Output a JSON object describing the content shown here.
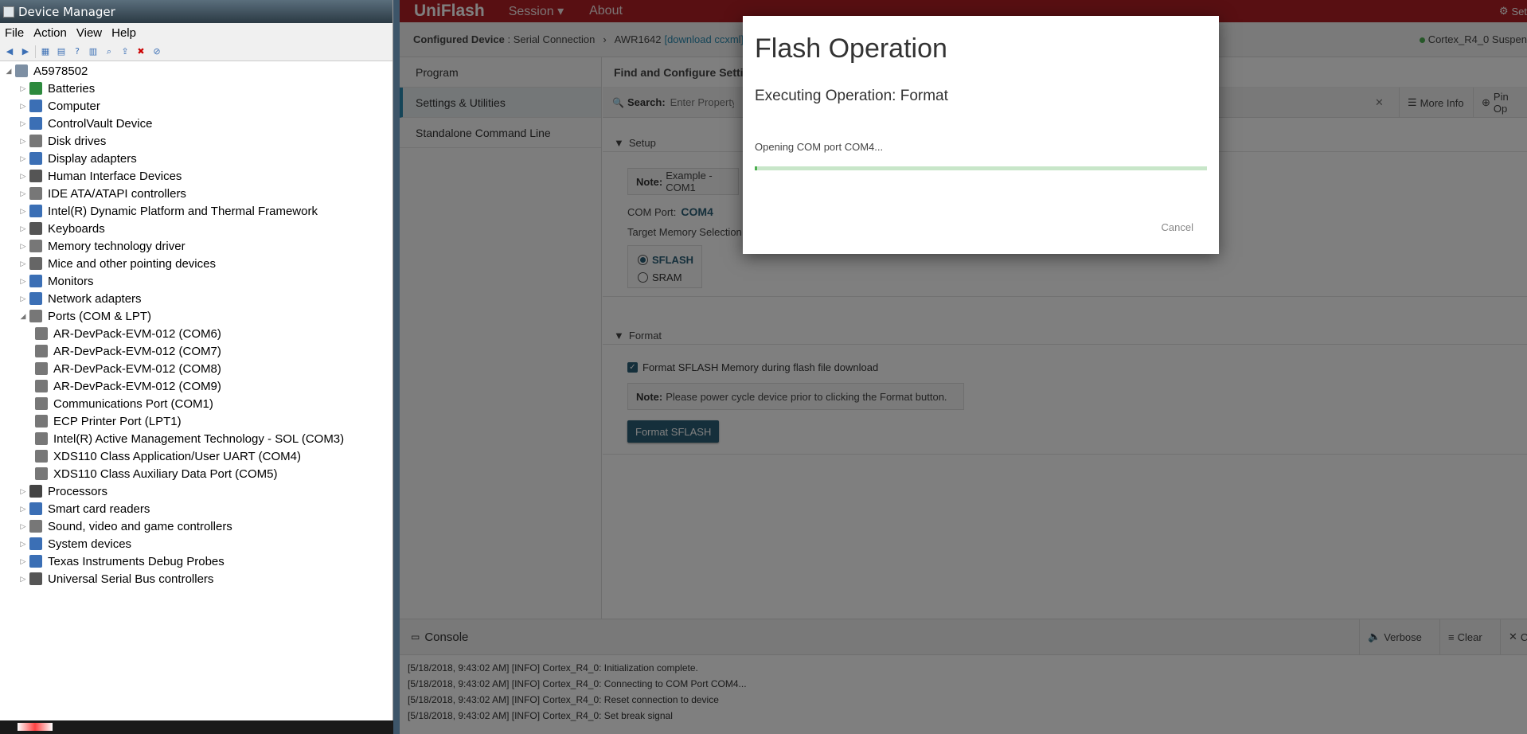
{
  "device_manager": {
    "title": "Device Manager",
    "menu": [
      "File",
      "Action",
      "View",
      "Help"
    ],
    "root": "A5978502",
    "items": [
      {
        "label": "Batteries",
        "icon": "battery-icon",
        "color": "#2d8a3e",
        "level": 1,
        "expanded": false
      },
      {
        "label": "Computer",
        "icon": "computer-icon",
        "color": "#3b6fb5",
        "level": 1,
        "expanded": false
      },
      {
        "label": "ControlVault Device",
        "icon": "security-device-icon",
        "color": "#3b6fb5",
        "level": 1,
        "expanded": false
      },
      {
        "label": "Disk drives",
        "icon": "disk-drive-icon",
        "color": "#777777",
        "level": 1,
        "expanded": false
      },
      {
        "label": "Display adapters",
        "icon": "display-adapter-icon",
        "color": "#3b6fb5",
        "level": 1,
        "expanded": false
      },
      {
        "label": "Human Interface Devices",
        "icon": "hid-icon",
        "color": "#555555",
        "level": 1,
        "expanded": false
      },
      {
        "label": "IDE ATA/ATAPI controllers",
        "icon": "ide-controller-icon",
        "color": "#777777",
        "level": 1,
        "expanded": false
      },
      {
        "label": "Intel(R) Dynamic Platform and Thermal Framework",
        "icon": "thermal-framework-icon",
        "color": "#3b6fb5",
        "level": 1,
        "expanded": false
      },
      {
        "label": "Keyboards",
        "icon": "keyboard-icon",
        "color": "#555555",
        "level": 1,
        "expanded": false
      },
      {
        "label": "Memory technology driver",
        "icon": "memory-driver-icon",
        "color": "#777777",
        "level": 1,
        "expanded": false
      },
      {
        "label": "Mice and other pointing devices",
        "icon": "mouse-icon",
        "color": "#666666",
        "level": 1,
        "expanded": false
      },
      {
        "label": "Monitors",
        "icon": "monitor-icon",
        "color": "#3b6fb5",
        "level": 1,
        "expanded": false
      },
      {
        "label": "Network adapters",
        "icon": "network-adapter-icon",
        "color": "#3b6fb5",
        "level": 1,
        "expanded": false
      },
      {
        "label": "Ports (COM & LPT)",
        "icon": "port-icon",
        "color": "#777777",
        "level": 1,
        "expanded": true
      },
      {
        "label": "AR-DevPack-EVM-012 (COM6)",
        "icon": "port-icon",
        "color": "#777777",
        "level": 2
      },
      {
        "label": "AR-DevPack-EVM-012 (COM7)",
        "icon": "port-icon",
        "color": "#777777",
        "level": 2
      },
      {
        "label": "AR-DevPack-EVM-012 (COM8)",
        "icon": "port-icon",
        "color": "#777777",
        "level": 2
      },
      {
        "label": "AR-DevPack-EVM-012 (COM9)",
        "icon": "port-icon",
        "color": "#777777",
        "level": 2
      },
      {
        "label": "Communications Port (COM1)",
        "icon": "port-icon",
        "color": "#777777",
        "level": 2
      },
      {
        "label": "ECP Printer Port (LPT1)",
        "icon": "port-icon",
        "color": "#777777",
        "level": 2
      },
      {
        "label": "Intel(R) Active Management Technology - SOL (COM3)",
        "icon": "port-icon",
        "color": "#777777",
        "level": 2
      },
      {
        "label": "XDS110 Class Application/User UART (COM4)",
        "icon": "port-icon",
        "color": "#777777",
        "level": 2
      },
      {
        "label": "XDS110 Class Auxiliary Data Port (COM5)",
        "icon": "port-icon",
        "color": "#777777",
        "level": 2
      },
      {
        "label": "Processors",
        "icon": "processor-icon",
        "color": "#444444",
        "level": 1,
        "expanded": false
      },
      {
        "label": "Smart card readers",
        "icon": "smart-card-icon",
        "color": "#3b6fb5",
        "level": 1,
        "expanded": false
      },
      {
        "label": "Sound, video and game controllers",
        "icon": "sound-icon",
        "color": "#777777",
        "level": 1,
        "expanded": false
      },
      {
        "label": "System devices",
        "icon": "system-device-icon",
        "color": "#3b6fb5",
        "level": 1,
        "expanded": false
      },
      {
        "label": "Texas Instruments Debug Probes",
        "icon": "debug-probe-icon",
        "color": "#3b6fb5",
        "level": 1,
        "expanded": false
      },
      {
        "label": "Universal Serial Bus controllers",
        "icon": "usb-icon",
        "color": "#555555",
        "level": 1,
        "expanded": false
      }
    ]
  },
  "uniflash": {
    "brand": "UniFlash",
    "nav": {
      "session": "Session",
      "about": "About"
    },
    "settings_label": "Set",
    "breadcrumb": {
      "configured_label": "Configured Device",
      "connection": ": Serial Connection",
      "device": "AWR1642",
      "download_link": "[download ccxml]"
    },
    "status": "Cortex_R4_0 Suspen",
    "left_nav": [
      "Program",
      "Settings & Utilities",
      "Standalone Command Line"
    ],
    "main_title": "Find and Configure Settin",
    "search": {
      "label": "Search:",
      "placeholder": "Enter Property ID"
    },
    "more_info": "More Info",
    "pin_options": "Pin Op",
    "setup": {
      "heading": "Setup",
      "note_label": "Note:",
      "note_text": "Example - COM1",
      "com_port_label": "COM Port:",
      "com_port_value": "COM4",
      "target_memory_label": "Target Memory Selection",
      "options": [
        "SFLASH",
        "SRAM"
      ]
    },
    "format": {
      "heading": "Format",
      "checkbox_label": "Format SFLASH Memory during flash file download",
      "note_label": "Note:",
      "note_text": "Please power cycle device prior to clicking the Format button.",
      "button": "Format SFLASH"
    },
    "console": {
      "title": "Console",
      "verbose": "Verbose",
      "clear": "Clear",
      "close": "C",
      "lines": [
        "[5/18/2018, 9:43:02 AM] [INFO] Cortex_R4_0: Initialization complete.",
        "[5/18/2018, 9:43:02 AM] [INFO] Cortex_R4_0: Connecting to COM Port COM4...",
        "[5/18/2018, 9:43:02 AM] [INFO] Cortex_R4_0: Reset connection to device",
        "[5/18/2018, 9:43:02 AM] [INFO] Cortex_R4_0: Set break signal"
      ]
    }
  },
  "dialog": {
    "title": "Flash Operation",
    "subtitle": "Executing Operation: Format",
    "status": "Opening COM port COM4...",
    "progress": 0.006,
    "cancel": "Cancel"
  },
  "colors": {
    "brand_red": "#b11f24",
    "accent_teal": "#2a5f77",
    "progress_green": "#4caf50"
  }
}
